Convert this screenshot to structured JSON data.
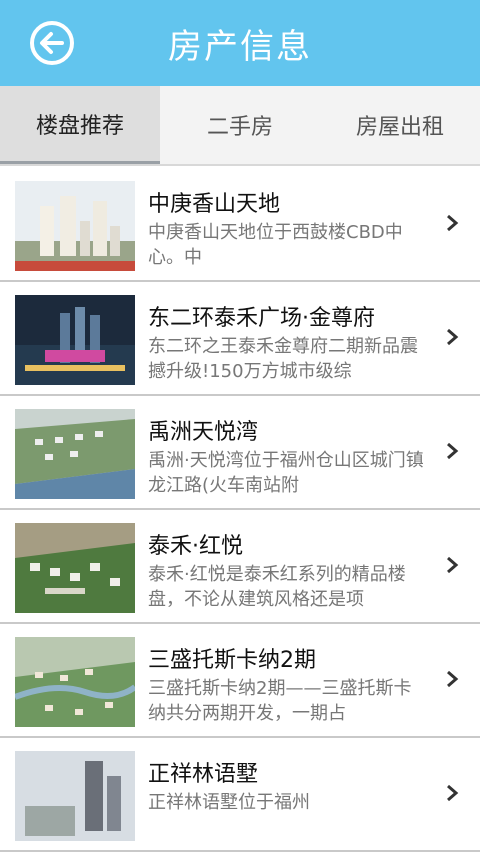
{
  "header": {
    "title": "房产信息"
  },
  "tabs": [
    {
      "label": "楼盘推荐",
      "active": true
    },
    {
      "label": "二手房",
      "active": false
    },
    {
      "label": "房屋出租",
      "active": false
    }
  ],
  "listings": [
    {
      "name": "中庚香山天地",
      "desc": "中庚香山天地位于西鼓楼CBD中心。中"
    },
    {
      "name": "东二环泰禾广场·金尊府",
      "desc": "东二环之王泰禾金尊府二期新品震撼升级!150万方城市级综"
    },
    {
      "name": "禹洲天悦湾",
      "desc": "禹洲·天悦湾位于福州仓山区城门镇龙江路(火车南站附"
    },
    {
      "name": "泰禾·红悦",
      "desc": "泰禾·红悦是泰禾红系列的精品楼盘，不论从建筑风格还是项"
    },
    {
      "name": "三盛托斯卡纳2期",
      "desc": "三盛托斯卡纳2期——三盛托斯卡纳共分两期开发，一期占"
    },
    {
      "name": "正祥林语墅",
      "desc": "正祥林语墅位于福州"
    }
  ],
  "colors": {
    "header": "#62c5ee",
    "tab_bg": "#f3f3f3",
    "tab_active": "#dedede",
    "divider": "#c9c9c9"
  }
}
